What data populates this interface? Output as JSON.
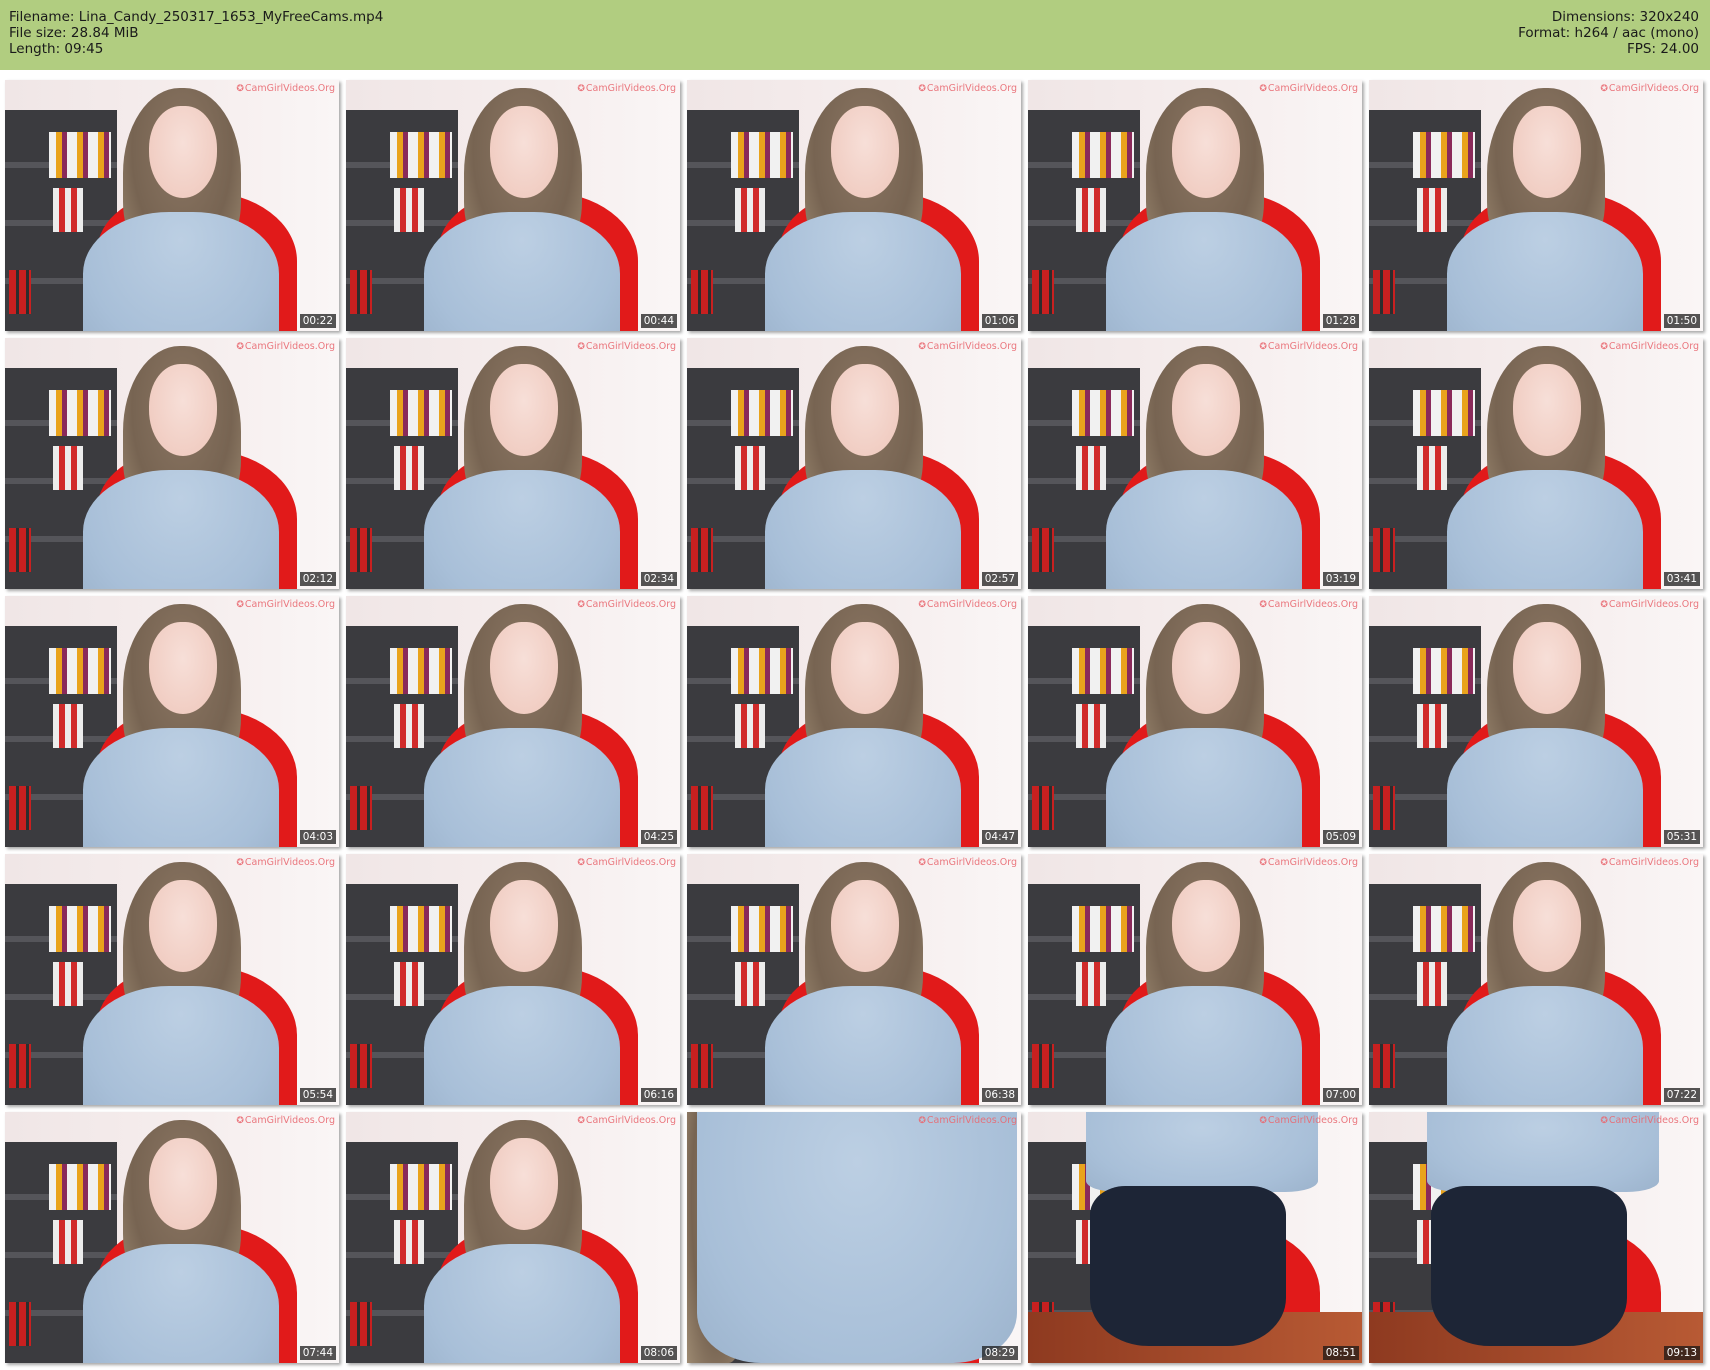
{
  "header": {
    "left": [
      "Filename: Lina_Candy_250317_1653_MyFreeCams.mp4",
      "File size: 28.84 MiB",
      "Length: 09:45"
    ],
    "right": [
      "Dimensions: 320x240",
      "Format: h264 / aac (mono)",
      "FPS: 24.00"
    ],
    "bg_color": "#b1cd80"
  },
  "watermark": "CamGirlVideos.Org",
  "thumbnails": [
    {
      "timestamp": "00:22"
    },
    {
      "timestamp": "00:44"
    },
    {
      "timestamp": "01:06"
    },
    {
      "timestamp": "01:28"
    },
    {
      "timestamp": "01:50"
    },
    {
      "timestamp": "02:12"
    },
    {
      "timestamp": "02:34"
    },
    {
      "timestamp": "02:57"
    },
    {
      "timestamp": "03:19"
    },
    {
      "timestamp": "03:41"
    },
    {
      "timestamp": "04:03"
    },
    {
      "timestamp": "04:25"
    },
    {
      "timestamp": "04:47"
    },
    {
      "timestamp": "05:09"
    },
    {
      "timestamp": "05:31"
    },
    {
      "timestamp": "05:54"
    },
    {
      "timestamp": "06:16"
    },
    {
      "timestamp": "06:38"
    },
    {
      "timestamp": "07:00"
    },
    {
      "timestamp": "07:22"
    },
    {
      "timestamp": "07:44"
    },
    {
      "timestamp": "08:06"
    },
    {
      "timestamp": "08:29"
    },
    {
      "timestamp": "08:51"
    },
    {
      "timestamp": "09:13"
    }
  ]
}
